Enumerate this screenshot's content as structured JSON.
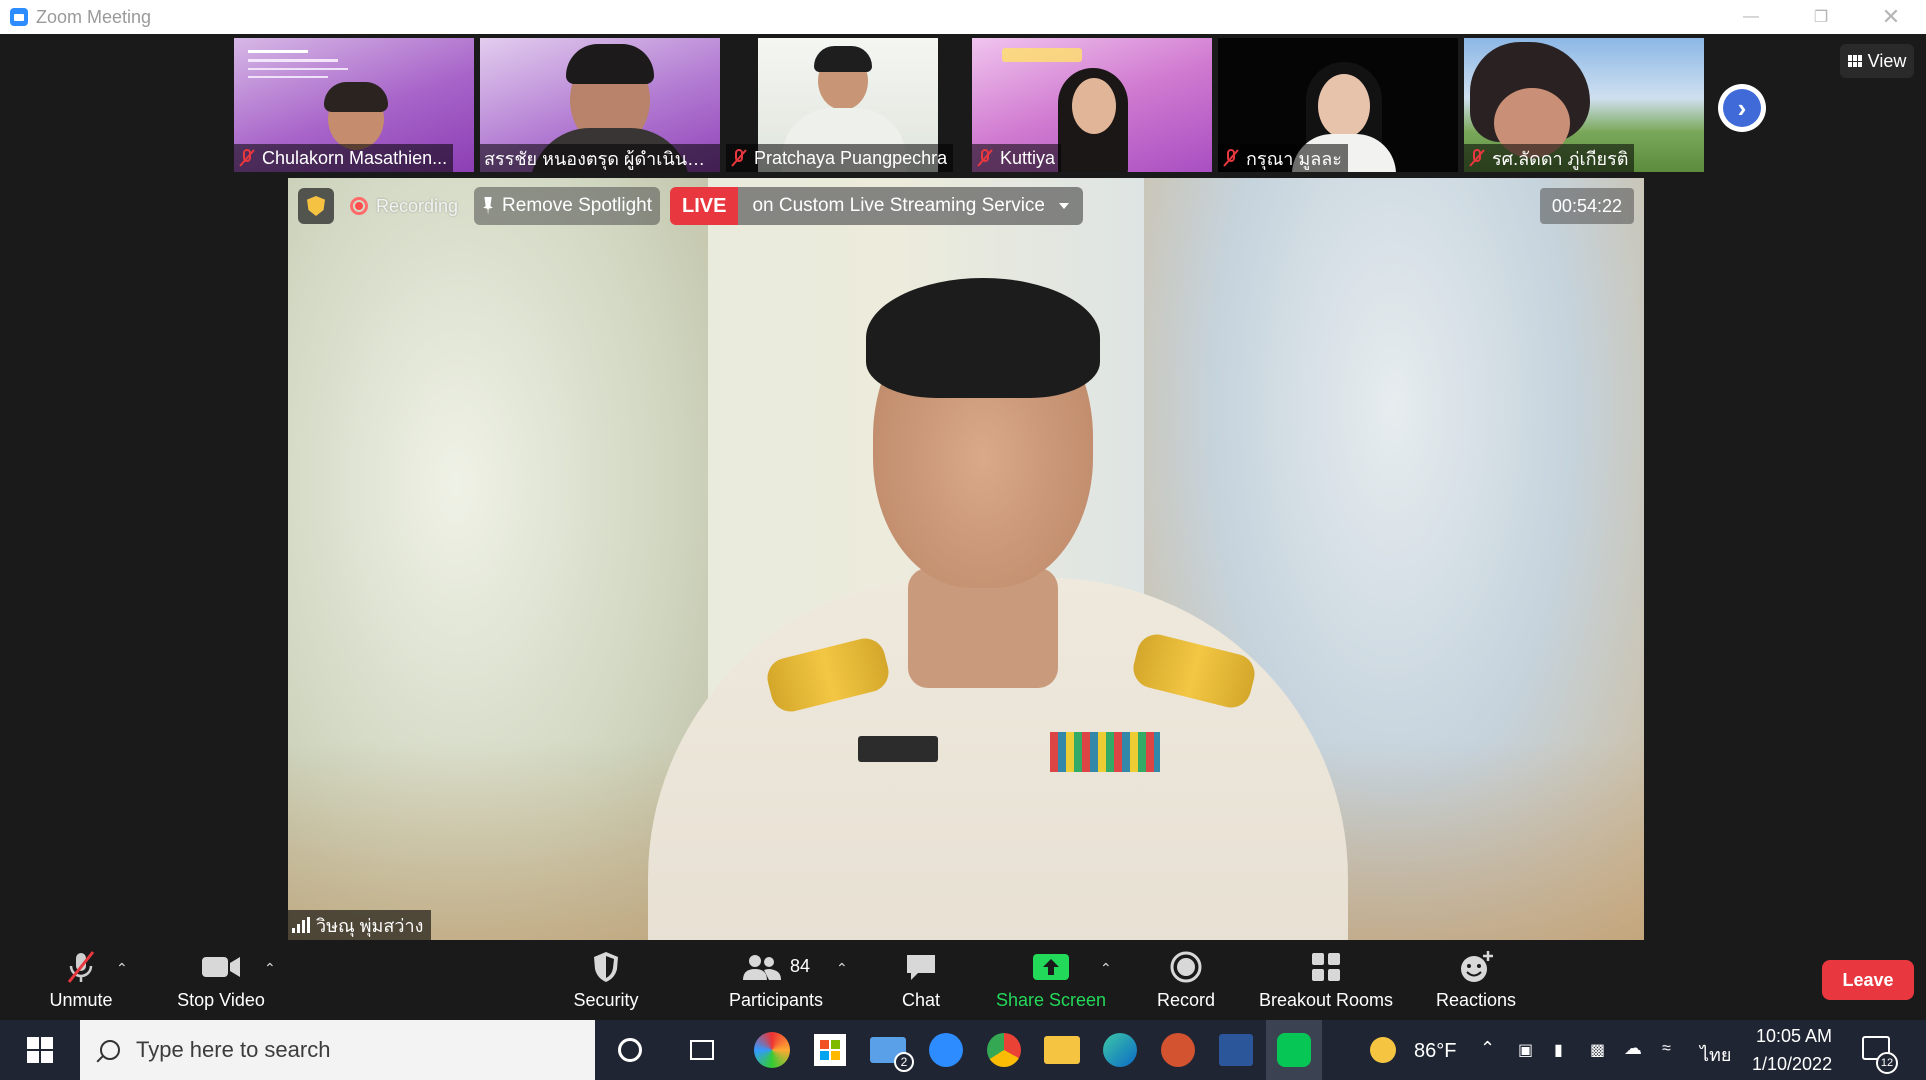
{
  "window": {
    "title": "Zoom Meeting"
  },
  "gallery": [
    {
      "name": "Chulakorn Masathien...",
      "muted": true
    },
    {
      "name": "สรรชัย หนองตรุด ผู้ดำเนินราย...",
      "muted": true
    },
    {
      "name": "Pratchaya Puangpechra",
      "muted": true
    },
    {
      "name": "Kuttiya",
      "muted": true
    },
    {
      "name": "กรุณา มูลละ",
      "muted": true
    },
    {
      "name": "รศ.ลัดดา ภู่เกียรติ",
      "muted": true
    }
  ],
  "view_button": {
    "label": "View"
  },
  "meeting_tools": {
    "recording_label": "Recording",
    "spotlight_label": "Remove Spotlight",
    "live_tag": "LIVE",
    "live_service": "on Custom Live Streaming Service",
    "timer": "00:54:22"
  },
  "main_speaker": {
    "name": "วิษณุ พุ่มสว่าง"
  },
  "toolbar": {
    "unmute": "Unmute",
    "stop_video": "Stop Video",
    "security": "Security",
    "participants": "Participants",
    "participants_count": "84",
    "chat": "Chat",
    "share_screen": "Share Screen",
    "record": "Record",
    "breakout_rooms": "Breakout Rooms",
    "reactions": "Reactions",
    "leave": "Leave"
  },
  "colors": {
    "accent_blue": "#2d8cff",
    "leave_red": "#e8373e",
    "share_green": "#23d959",
    "toolbar_bg": "#1a1a1a"
  },
  "taskbar": {
    "search_placeholder": "Type here to search",
    "mail_badge": "2",
    "temperature": "86°F",
    "language": "ไทย",
    "time": "10:05 AM",
    "date": "1/10/2022",
    "notification_count": "12"
  }
}
